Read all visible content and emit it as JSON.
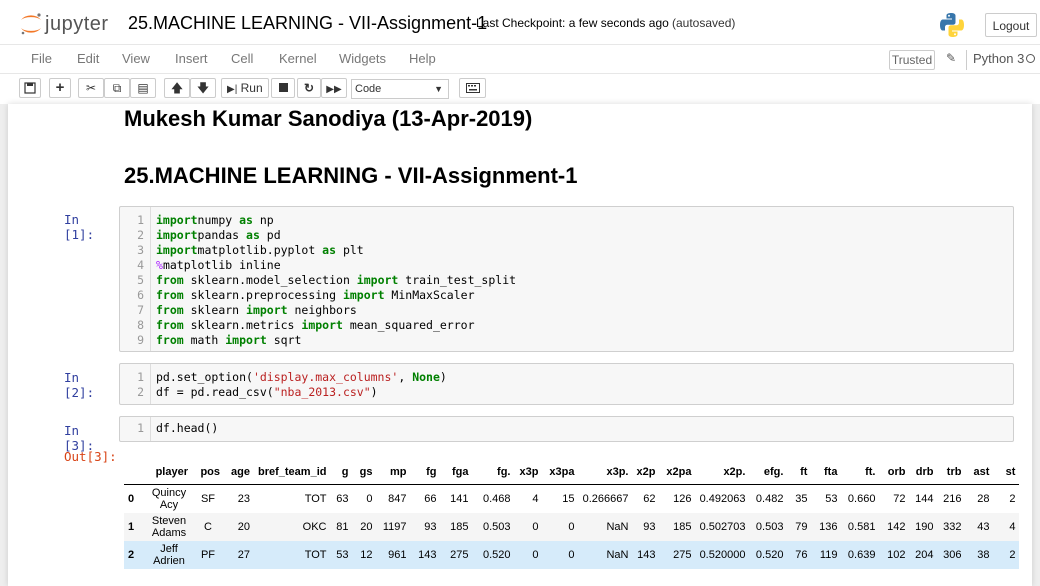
{
  "header": {
    "logo_text": "jupyter",
    "notebook_title": "25.MACHINE LEARNING - VII-Assignment-1",
    "checkpoint": "Last Checkpoint: a few seconds ago",
    "autosave": "(autosaved)",
    "logout_label": "Logout"
  },
  "menu": {
    "items": [
      "File",
      "Edit",
      "View",
      "Insert",
      "Cell",
      "Kernel",
      "Widgets",
      "Help"
    ],
    "trusted_label": "Trusted",
    "kernel_name": "Python 3"
  },
  "toolbar": {
    "run_label": "Run",
    "cell_type": "Code"
  },
  "notebook": {
    "heading1": "Mukesh Kumar Sanodiya (13-Apr-2019)",
    "heading2": "25.MACHINE LEARNING - VII-Assignment-1",
    "cells": [
      {
        "prompt": "In [1]:",
        "lines": [
          [
            [
              "kw",
              "import"
            ],
            [
              "",
              "numpy "
            ],
            [
              "kw",
              "as"
            ],
            [
              "",
              " np"
            ]
          ],
          [
            [
              "kw",
              "import"
            ],
            [
              "",
              "pandas "
            ],
            [
              "kw",
              "as"
            ],
            [
              "",
              " pd"
            ]
          ],
          [
            [
              "kw",
              "import"
            ],
            [
              "",
              "matplotlib.pyplot "
            ],
            [
              "kw",
              "as"
            ],
            [
              "",
              " plt"
            ]
          ],
          [
            [
              "mg",
              "%"
            ],
            [
              "",
              "matplotlib inline"
            ]
          ],
          [
            [
              "kw",
              "from"
            ],
            [
              "",
              " sklearn.model_selection "
            ],
            [
              "kw",
              "import"
            ],
            [
              "",
              " train_test_split"
            ]
          ],
          [
            [
              "kw",
              "from"
            ],
            [
              "",
              " sklearn.preprocessing "
            ],
            [
              "kw",
              "import"
            ],
            [
              "",
              " MinMaxScaler"
            ]
          ],
          [
            [
              "kw",
              "from"
            ],
            [
              "",
              " sklearn "
            ],
            [
              "kw",
              "import"
            ],
            [
              "",
              " neighbors"
            ]
          ],
          [
            [
              "kw",
              "from"
            ],
            [
              "",
              " sklearn.metrics "
            ],
            [
              "kw",
              "import"
            ],
            [
              "",
              " mean_squared_error"
            ]
          ],
          [
            [
              "kw",
              "from"
            ],
            [
              "",
              " math "
            ],
            [
              "kw",
              "import"
            ],
            [
              "",
              " sqrt"
            ]
          ]
        ]
      },
      {
        "prompt": "In [2]:",
        "lines": [
          [
            [
              "",
              "pd.set_option("
            ],
            [
              "st",
              "'display.max_columns'"
            ],
            [
              "",
              ", "
            ],
            [
              "kw",
              "None"
            ],
            [
              "",
              ")"
            ]
          ],
          [
            [
              "",
              "df = pd.read_csv("
            ],
            [
              "st",
              "\"nba_2013.csv\""
            ],
            [
              "",
              ")"
            ]
          ]
        ]
      },
      {
        "prompt": "In [3]:",
        "lines": [
          [
            [
              "",
              "df.head()"
            ]
          ]
        ]
      }
    ],
    "output_prompt": "Out[3]:",
    "dataframe": {
      "columns": [
        "player",
        "pos",
        "age",
        "bref_team_id",
        "g",
        "gs",
        "mp",
        "fg",
        "fga",
        "fg.",
        "x3p",
        "x3pa",
        "x3p.",
        "x2p",
        "x2pa",
        "x2p.",
        "efg.",
        "ft",
        "fta",
        "ft.",
        "orb",
        "drb",
        "trb",
        "ast",
        "st"
      ],
      "rows": [
        {
          "index": "0",
          "cells": [
            "Quincy Acy",
            "SF",
            "23",
            "TOT",
            "63",
            "0",
            "847",
            "66",
            "141",
            "0.468",
            "4",
            "15",
            "0.266667",
            "62",
            "126",
            "0.492063",
            "0.482",
            "35",
            "53",
            "0.660",
            "72",
            "144",
            "216",
            "28",
            "2"
          ]
        },
        {
          "index": "1",
          "cells": [
            "Steven Adams",
            "C",
            "20",
            "OKC",
            "81",
            "20",
            "1197",
            "93",
            "185",
            "0.503",
            "0",
            "0",
            "NaN",
            "93",
            "185",
            "0.502703",
            "0.503",
            "79",
            "136",
            "0.581",
            "142",
            "190",
            "332",
            "43",
            "4"
          ]
        },
        {
          "index": "2",
          "cells": [
            "Jeff Adrien",
            "PF",
            "27",
            "TOT",
            "53",
            "12",
            "961",
            "143",
            "275",
            "0.520",
            "0",
            "0",
            "NaN",
            "143",
            "275",
            "0.520000",
            "0.520",
            "76",
            "119",
            "0.639",
            "102",
            "204",
            "306",
            "38",
            "2"
          ]
        }
      ]
    }
  }
}
